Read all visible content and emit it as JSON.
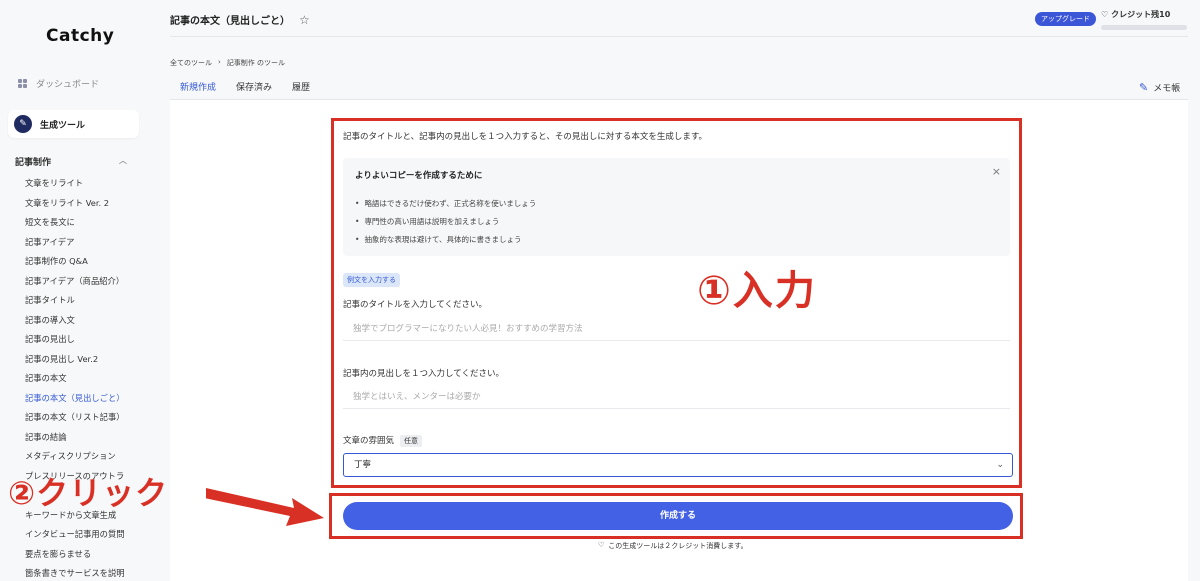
{
  "sidebar": {
    "logo": "Catchy",
    "dashboard": "ダッシュボード",
    "gen_tools": "生成ツール",
    "section": "記事制作",
    "items": [
      "文章をリライト",
      "文章をリライト Ver. 2",
      "短文を長文に",
      "記事アイデア",
      "記事制作の Q&A",
      "記事アイデア（商品紹介）",
      "記事タイトル",
      "記事の導入文",
      "記事の見出し",
      "記事の見出し Ver.2",
      "記事の本文",
      "記事の本文（見出しごと）",
      "記事の本文（リスト記事）",
      "記事の結論",
      "メタディスクリプション",
      "プレスリリースのアウトラ",
      "",
      "キーワードから文章生成",
      "インタビュー記事用の質問",
      "要点を膨らませる",
      "箇条書きでサービスを説明"
    ]
  },
  "header": {
    "title": "記事の本文（見出しごと）",
    "star": "☆",
    "upgrade": "アップグレード",
    "credit": "クレジット残10"
  },
  "breadcrumb": {
    "root": "全てのツール",
    "sep": "›",
    "current": "記事制作 のツール"
  },
  "tabs": [
    "新規作成",
    "保存済み",
    "履歴"
  ],
  "memo": "メモ帳",
  "form": {
    "intro": "記事のタイトルと、記事内の見出しを１つ入力すると、その見出しに対する本文を生成します。",
    "tips_title": "よりよいコピーを作成するために",
    "tips": [
      "略語はできるだけ使わず、正式名称を使いましょう",
      "専門性の高い用語は説明を加えましょう",
      "抽象的な表現は避けて、具体的に書きましょう"
    ],
    "sample_button": "例文を入力する",
    "title_label": "記事のタイトルを入力してください。",
    "title_placeholder": "独学でプログラマーになりたい人必見！おすすめの学習方法",
    "heading_label": "記事内の見出しを１つ入力してください。",
    "heading_placeholder": "独学とはいえ、メンターは必要か",
    "tone_label": "文章の雰囲気",
    "optional": "任意",
    "tone_value": "丁寧",
    "submit": "作成する",
    "credit_note": "この生成ツールは２クレジット消費します。"
  },
  "annotations": {
    "input": "①入力",
    "click": "②クリック"
  },
  "colors": {
    "accent": "#3559d6",
    "annotation": "#d93025",
    "button": "#4361e4"
  }
}
